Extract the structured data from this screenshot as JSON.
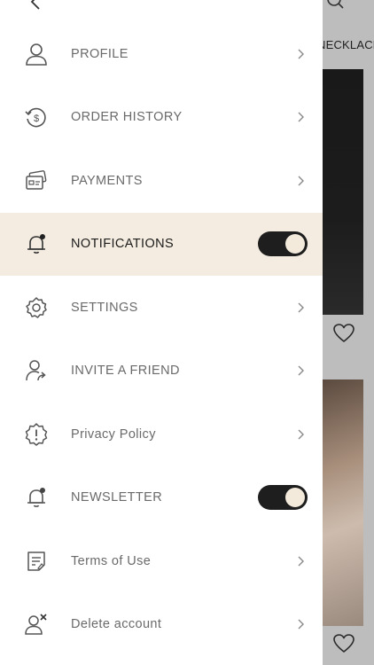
{
  "background": {
    "category_label": "NECKLACE"
  },
  "menu": {
    "items": [
      {
        "label": "PROFILE",
        "icon": "user-icon"
      },
      {
        "label": "ORDER HISTORY",
        "icon": "order-history-icon"
      },
      {
        "label": "PAYMENTS",
        "icon": "card-icon"
      },
      {
        "label": "NOTIFICATIONS",
        "icon": "bell-icon",
        "toggle": true,
        "active": true
      },
      {
        "label": "SETTINGS",
        "icon": "gear-icon"
      },
      {
        "label": "INVITE A FRIEND",
        "icon": "invite-friend-icon"
      },
      {
        "label": "Privacy Policy",
        "icon": "privacy-icon"
      },
      {
        "label": "NEWSLETTER",
        "icon": "bell-icon",
        "toggle": true
      },
      {
        "label": "Terms of Use",
        "icon": "terms-icon"
      },
      {
        "label": "Delete account",
        "icon": "delete-account-icon"
      }
    ]
  },
  "colors": {
    "accent_active_row": "#f4ece0",
    "toggle_on": "#1e1e1e",
    "toggle_knob": "#f3eadc",
    "label_text": "#6a6a6a"
  }
}
